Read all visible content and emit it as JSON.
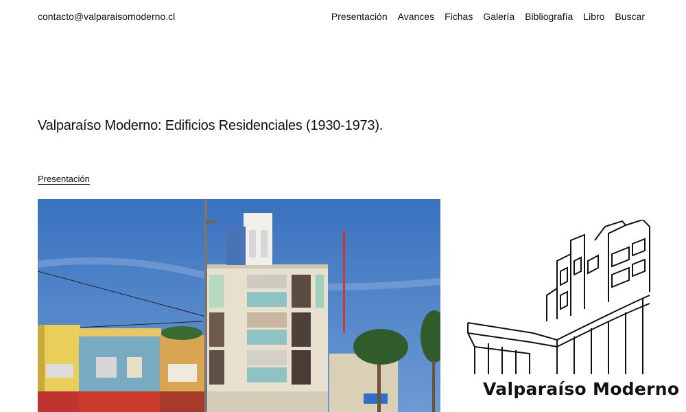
{
  "header": {
    "contact": "contacto@valparaisomoderno.cl",
    "nav": [
      "Presentación",
      "Avances",
      "Fichas",
      "Galería",
      "Bibliografía",
      "Libro",
      "Buscar"
    ]
  },
  "main": {
    "title": "Valparaíso Moderno: Edificios Residenciales (1930-1973).",
    "breadcrumb": "Presentación"
  },
  "logo": {
    "text": "Valparaíso Moderno"
  },
  "colors": {
    "sky": "#3f78c2",
    "text": "#111111",
    "background": "#ffffff"
  }
}
